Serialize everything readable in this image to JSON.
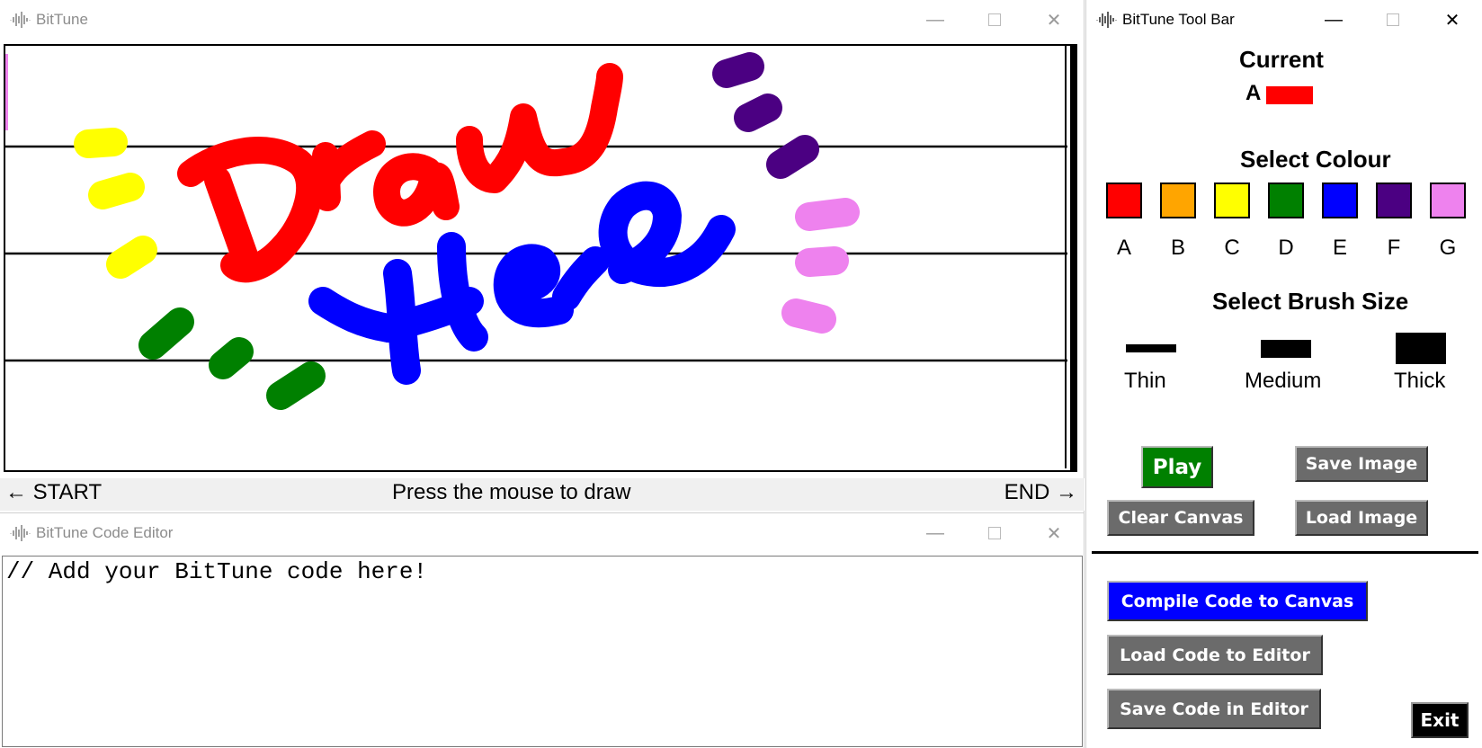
{
  "draw_window": {
    "title": "BitTune",
    "status": {
      "start": "← START",
      "message": "Press the mouse to draw",
      "end": "END →"
    }
  },
  "code_window": {
    "title": "BitTune Code Editor",
    "code": "// Add your BitTune code here!"
  },
  "toolbar": {
    "title": "BitTune Tool Bar",
    "current_heading": "Current",
    "current_note": "A",
    "current_color": "#ff0000",
    "colour_heading": "Select Colour",
    "colours": [
      {
        "label": "A",
        "color": "#ff0000"
      },
      {
        "label": "B",
        "color": "#ffa500"
      },
      {
        "label": "C",
        "color": "#ffff00"
      },
      {
        "label": "D",
        "color": "#008000"
      },
      {
        "label": "E",
        "color": "#0000ff"
      },
      {
        "label": "F",
        "color": "#4b0082"
      },
      {
        "label": "G",
        "color": "#ee82ee"
      }
    ],
    "brush_heading": "Select Brush Size",
    "brushes": [
      {
        "label": "Thin"
      },
      {
        "label": "Medium"
      },
      {
        "label": "Thick"
      }
    ],
    "buttons": {
      "play": "Play",
      "save_image": "Save Image",
      "clear_canvas": "Clear Canvas",
      "load_image": "Load Image",
      "compile": "Compile Code to Canvas",
      "load_code": "Load Code to Editor",
      "save_code": "Save Code in Editor",
      "exit": "Exit"
    }
  }
}
